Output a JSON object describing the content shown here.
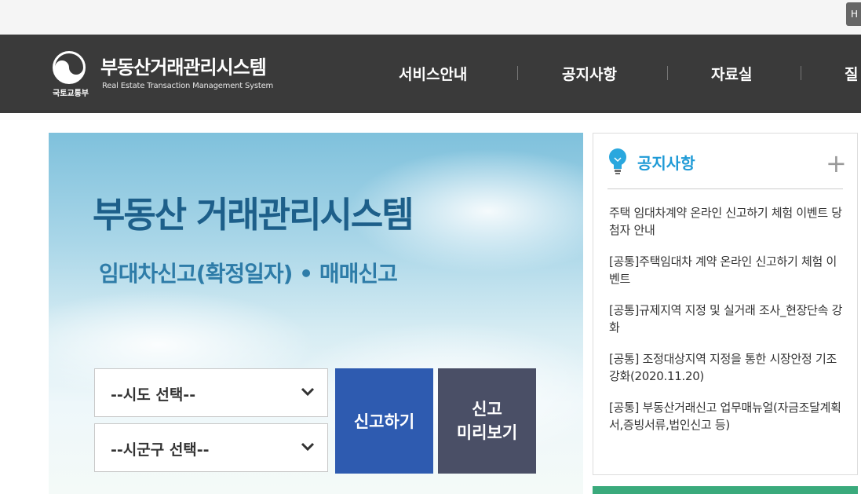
{
  "topbar": {
    "button_label": "H"
  },
  "header": {
    "ministry": "국토교통부",
    "site_title": "부동산거래관리시스템",
    "site_subtitle": "Real Estate Transaction Management System",
    "nav": [
      {
        "label": "서비스안내"
      },
      {
        "label": "공지사항"
      },
      {
        "label": "자료실"
      },
      {
        "label": "질"
      }
    ]
  },
  "hero": {
    "title": "부동산 거래관리시스템",
    "subtitle": "임대차신고(확정일자) • 매매신고",
    "select_sido": "--시도 선택--",
    "select_sigungu": "--시군구 선택--",
    "report_button": "신고하기",
    "preview_button_line1": "신고",
    "preview_button_line2": "미리보기"
  },
  "notice": {
    "title": "공지사항",
    "more": "+",
    "items": [
      {
        "text": "주택 임대차계약 온라인 신고하기 체험 이벤트 당첨자 안내"
      },
      {
        "text": "[공통]주택임대차 계약 온라인 신고하기 체험 이벤트"
      },
      {
        "text": "[공통]규제지역 지정 및 실거래 조사_현장단속 강화"
      },
      {
        "text": "[공통] 조정대상지역 지정을 통한 시장안정 기조 강화(2020.11.20)"
      },
      {
        "text": "[공통] 부동산거래신고 업무매뉴얼(자금조달계획서,증빙서류,법인신고 등)"
      }
    ]
  },
  "colors": {
    "header_bg": "#3a3a3a",
    "report_button": "#2e5bb0",
    "preview_button": "#4a4f66",
    "notice_title": "#1e9ad6",
    "bottom_bar": "#3aaa7c"
  }
}
